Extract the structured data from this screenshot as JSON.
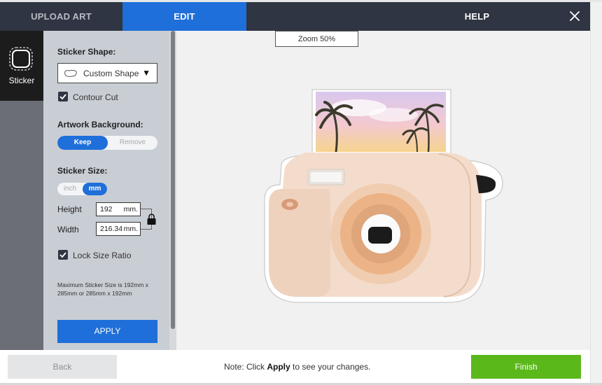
{
  "header": {
    "tabs": [
      {
        "label": "UPLOAD ART",
        "active": false
      },
      {
        "label": "EDIT",
        "active": true
      },
      {
        "label": "HELP",
        "active": false
      }
    ],
    "close_icon": "close-icon"
  },
  "rail": {
    "sticker_label": "Sticker",
    "sticker_icon": "sticker-outline-icon"
  },
  "panel": {
    "shape_title": "Sticker Shape:",
    "shape_value": "Custom Shape",
    "contour_cut_label": "Contour Cut",
    "contour_cut_checked": true,
    "background_title": "Artwork Background:",
    "background_options": [
      "Keep",
      "Remove"
    ],
    "background_selected": "Keep",
    "size_title": "Sticker Size:",
    "unit_options": [
      "inch",
      "mm"
    ],
    "unit_selected": "mm",
    "height_label": "Height",
    "height_value": "192",
    "height_unit": "mm.",
    "width_label": "Width",
    "width_value": "216.34",
    "width_unit": "mm.",
    "lock_ratio_label": "Lock Size Ratio",
    "lock_ratio_checked": true,
    "max_note": "Maximum Sticker Size is 192mm x 285mm or 285mm x 192mm",
    "apply_label": "APPLY"
  },
  "canvas": {
    "zoom_label": "Zoom 50%",
    "artwork": "instant-camera-sticker-image"
  },
  "footer": {
    "back_label": "Back",
    "note_prefix": "Note: Click ",
    "note_bold": "Apply",
    "note_suffix": " to see your changes.",
    "finish_label": "Finish"
  },
  "colors": {
    "header_bg": "#2f3542",
    "accent_blue": "#1e6fd9",
    "finish_green": "#5bb81b",
    "panel_bg": "#c9cdd4"
  }
}
